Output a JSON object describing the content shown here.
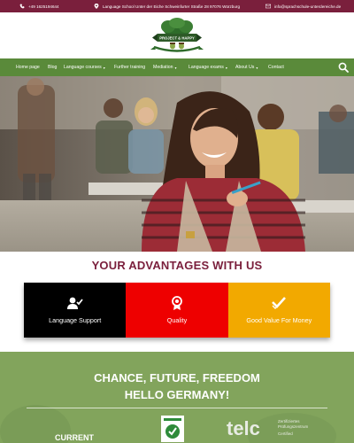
{
  "topbar": {
    "phone": "+49 1625194644",
    "address": "Language School Unter der Eiche Schweinfurter Straße 28 97076 Würzburg",
    "email": "info@sprachschule-unterdereiche.de"
  },
  "logo": {
    "banner_text": "PROJECT & HAPPY",
    "ribbon_text": "SPRACHSCHULE · UNTER DER EICHE"
  },
  "nav": {
    "items": [
      "Home page",
      "Blog",
      "Language courses",
      "Further training",
      "Mediation",
      "Language exams",
      "About Us",
      "Contact"
    ]
  },
  "advantages": {
    "title": "YOUR ADVANTAGES WITH US",
    "items": [
      {
        "label": "Language Support",
        "color": "#000000",
        "icon": "user-check-icon"
      },
      {
        "label": "Quality",
        "color": "#ee0000",
        "icon": "award-icon"
      },
      {
        "label": "Good Value For Money",
        "color": "#f2a900",
        "icon": "check-icon"
      }
    ]
  },
  "bottom": {
    "line1": "CHANCE, FUTURE, FREEDOM",
    "line2": "HELLO GERMANY!",
    "current": "CURRENT",
    "telc_main": "telc",
    "telc_sub1": "Zertifiziertes",
    "telc_sub2": "Prüfungszentrum",
    "telc_sub3": "Certified"
  },
  "colors": {
    "brand": "#7a1f3c",
    "nav": "#5a8a3a",
    "section": "#7ea05a"
  }
}
